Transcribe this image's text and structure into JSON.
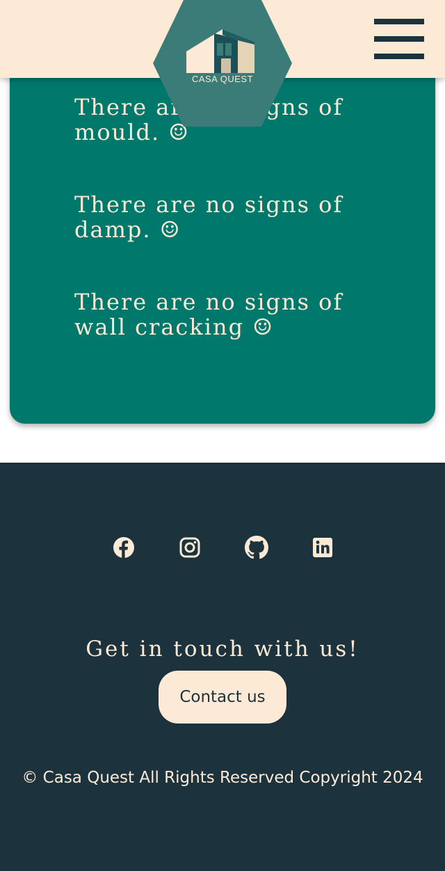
{
  "header": {
    "logo_text": "CASA QUEST",
    "menu_icon": "hamburger-menu-icon"
  },
  "results": {
    "lines": [
      "There are no signs of mould. ☺",
      "There are no signs of damp. ☺",
      "There are no signs of wall cracking ☺"
    ]
  },
  "footer": {
    "social_icons": [
      "facebook-icon",
      "instagram-icon",
      "github-icon",
      "linkedin-icon"
    ],
    "touch_heading": "Get in touch with us!",
    "contact_label": "Contact us",
    "copyright": "© Casa Quest All Rights Reserved Copyright 2024"
  },
  "colors": {
    "header_bg": "#fcead6",
    "card_bg": "#01786c",
    "footer_bg": "#1c323d",
    "logo_bg": "#3c7c78",
    "cream_text": "#fcead6"
  }
}
